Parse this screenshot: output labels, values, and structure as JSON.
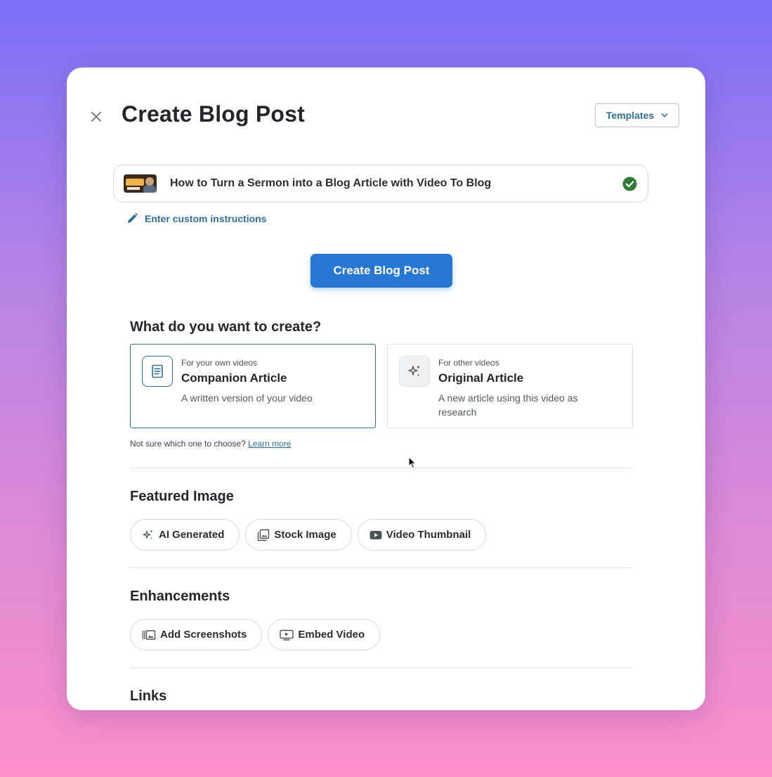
{
  "modal": {
    "title": "Create Blog Post",
    "templates_label": "Templates"
  },
  "video": {
    "title": "How to Turn a Sermon into a Blog Article with Video To Blog"
  },
  "custom_instructions_label": "Enter custom instructions",
  "primary_button_label": "Create Blog Post",
  "create_section": {
    "heading": "What do you want to create?",
    "options": [
      {
        "subtitle": "For your own videos",
        "name": "Companion Article",
        "description": "A written version of your video",
        "icon": "document-icon",
        "selected": true
      },
      {
        "subtitle": "For other videos",
        "name": "Original Article",
        "description": "A new article using this video as research",
        "icon": "sparkles-icon",
        "selected": false
      }
    ],
    "help_text": "Not sure which one to choose?",
    "help_link": "Learn more"
  },
  "featured_image": {
    "heading": "Featured Image",
    "options": [
      {
        "label": "AI Generated",
        "icon": "sparkles-icon"
      },
      {
        "label": "Stock Image",
        "icon": "image-gallery-icon"
      },
      {
        "label": "Video Thumbnail",
        "icon": "youtube-icon"
      }
    ]
  },
  "enhancements": {
    "heading": "Enhancements",
    "options": [
      {
        "label": "Add Screenshots",
        "icon": "screenshots-icon"
      },
      {
        "label": "Embed Video",
        "icon": "embed-video-icon"
      }
    ]
  },
  "links": {
    "heading": "Links"
  },
  "colors": {
    "accent": "#2577d3",
    "link": "#2f6f98",
    "success": "#2e7d32"
  }
}
